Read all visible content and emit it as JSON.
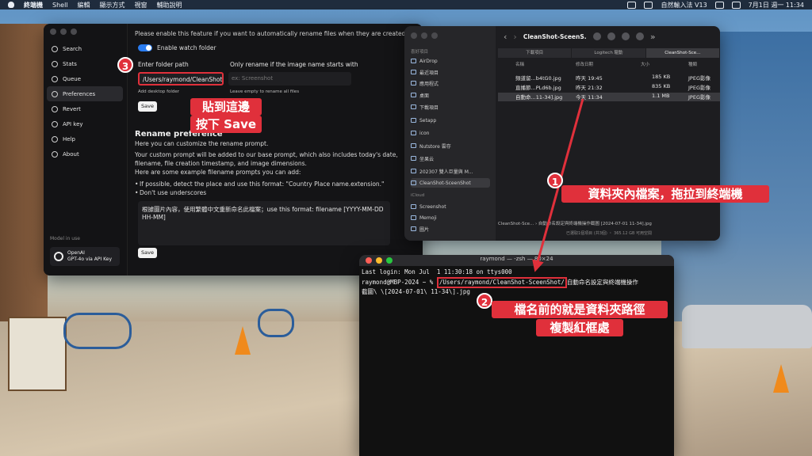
{
  "menubar": {
    "app": "終端機",
    "items": [
      "Shell",
      "編輯",
      "顯示方式",
      "視窗",
      "輔助說明"
    ],
    "input_method": "自然輸入法 V13",
    "clock": "7月1日 週一 11:34"
  },
  "app": {
    "nav": [
      "Search",
      "Stats",
      "Queue",
      "Preferences",
      "Revert",
      "API key",
      "Help",
      "About"
    ],
    "model_label": "Model in use",
    "model_name": "OpenAI",
    "model_sub": "GPT-4o via API Key",
    "notice": "Please enable this feature if you want to automatically rename files when they are created.",
    "watch_label": "Enable watch folder",
    "folder_label": "Enter folder path",
    "folder_value": "/Users/raymond/CleanShot",
    "prefix_label": "Only rename if the image name starts with",
    "prefix_placeholder": "ex: Screenshot",
    "add_desktop": "Add desktop folder",
    "leave_empty": "Leave empty to rename all files",
    "save_label": "Save",
    "rename_heading": "Rename preference",
    "rename_sub": "Here you can customize the rename prompt.",
    "para1": "Your custom prompt will be added to our base prompt, which also includes today's date,",
    "para2": "filename, file creation timestamp, and image dimensions.",
    "para3": "Here are some example filename prompts you can add:",
    "bullet1": "If possible, detect the place and use this format: \"Country Place name.extension.\"",
    "bullet2": "Don't use underscores",
    "prompt_line1": "根據圖片內容，使用繁體中文重新命名此檔案；use this format: filename [YYYY-MM-DD",
    "prompt_line2": "HH-MM]"
  },
  "finder": {
    "title": "CleanShot-SceenS...",
    "tabs": [
      "下載項目",
      "Logitech 驅動",
      "CleanShot-Sce..."
    ],
    "sidebar_section1": "喜好項目",
    "sidebar": [
      "AirDrop",
      "最近項目",
      "應用程式",
      "桌面",
      "下載項目",
      "Setapp",
      "icon",
      "Nutstore 雲存",
      "坐果云",
      "202307 雙人巨量與 M...",
      "CleanShot-SceenShot"
    ],
    "sidebar_section2": "iCloud",
    "sidebar2": [
      "Screenshot",
      "Memoji",
      "圖片"
    ],
    "col_name": "名稱",
    "col_date": "修改日期",
    "col_size": "大小",
    "col_kind": "種類",
    "files": [
      {
        "name": "頻道留...b4tG0.jpg",
        "date": "昨天 19:45",
        "size": "185 KB",
        "kind": "JPEG影像"
      },
      {
        "name": "直播節...PLd6b.jpg",
        "date": "昨天 21:32",
        "size": "835 KB",
        "kind": "JPEG影像"
      },
      {
        "name": "自動命...11-34].jpg",
        "date": "今天 11:34",
        "size": "1.1 MB",
        "kind": "JPEG影像"
      }
    ],
    "path": "CleanShot-Sce... › 自動命名設定與終端機操作截圖 [2024-07-01 11-34].jpg",
    "status": "已選取1個項目 (共3個) ・ 365.12 GB 可用空間"
  },
  "terminal": {
    "title": "raymond — -zsh — 80×24",
    "line1": "Last login: Mon Jul  1 11:30:18 on ttys000",
    "prompt": "raymond@MBP-2024 ~ % ",
    "path": "/Users/raymond/CleanShot-SceenShot/",
    "rest": "自動命名設定與終端機操作",
    "line3": "截圖\\ \\[2024-07-01\\ 11-34\\].jpg"
  },
  "annotations": {
    "n1": "1",
    "n2": "2",
    "n3": "3",
    "callout1": "資料夾內檔案，拖拉到終端機",
    "callout2a": "檔名前的就是資料夾路徑",
    "callout2b": "複製紅框處",
    "callout3a": "貼到這邊",
    "callout3b": "按下 Save"
  },
  "colors": {
    "accent": "#e0303b",
    "toggle": "#2a7cf0"
  }
}
